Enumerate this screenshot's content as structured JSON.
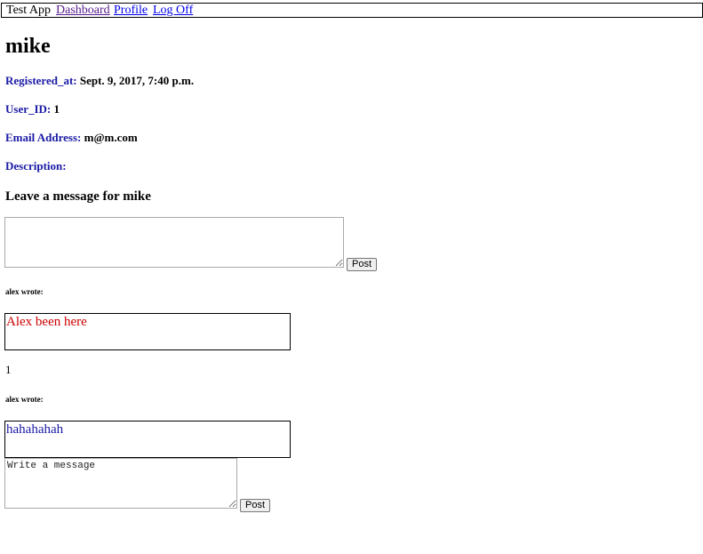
{
  "nav": {
    "brand": "Test App",
    "links": [
      "Dashboard",
      "Profile",
      "Log Off"
    ]
  },
  "profile": {
    "name": "mike",
    "registered_label": "Registered_at:",
    "registered_value": "Sept. 9, 2017, 7:40 p.m.",
    "userid_label": "User_ID:",
    "userid_value": "1",
    "email_label": "Email Address:",
    "email_value": "m@m.com",
    "description_label": "Description:",
    "description_value": ""
  },
  "message_form": {
    "heading": "Leave a message for mike",
    "value": "",
    "post_label": "Post"
  },
  "messages": [
    {
      "author_line": "alex wrote:",
      "text": "Alex been here",
      "text_color": "#cc0000",
      "count": "1"
    },
    {
      "author_line": "alex wrote:",
      "text": "hahahahah",
      "text_color": "#1a1aa6",
      "reply_placeholder": "Write a message",
      "reply_post_label": "Post"
    }
  ]
}
